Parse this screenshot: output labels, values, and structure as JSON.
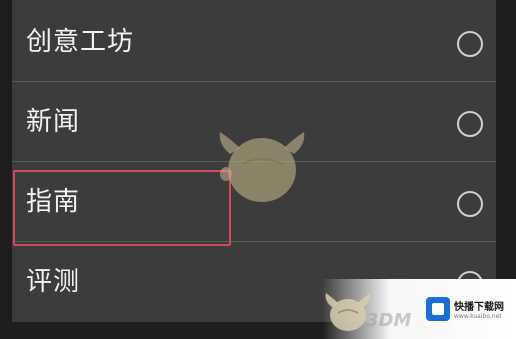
{
  "options": [
    {
      "label": "创意工坊",
      "selected": false
    },
    {
      "label": "新闻",
      "selected": false
    },
    {
      "label": "指南",
      "selected": false
    },
    {
      "label": "评测",
      "selected": false
    }
  ],
  "highlight_color": "#d24a5a",
  "watermark": {
    "brand_text": "3DM",
    "site_name": "快播下载网",
    "site_url": "www.kuaibo.net"
  }
}
